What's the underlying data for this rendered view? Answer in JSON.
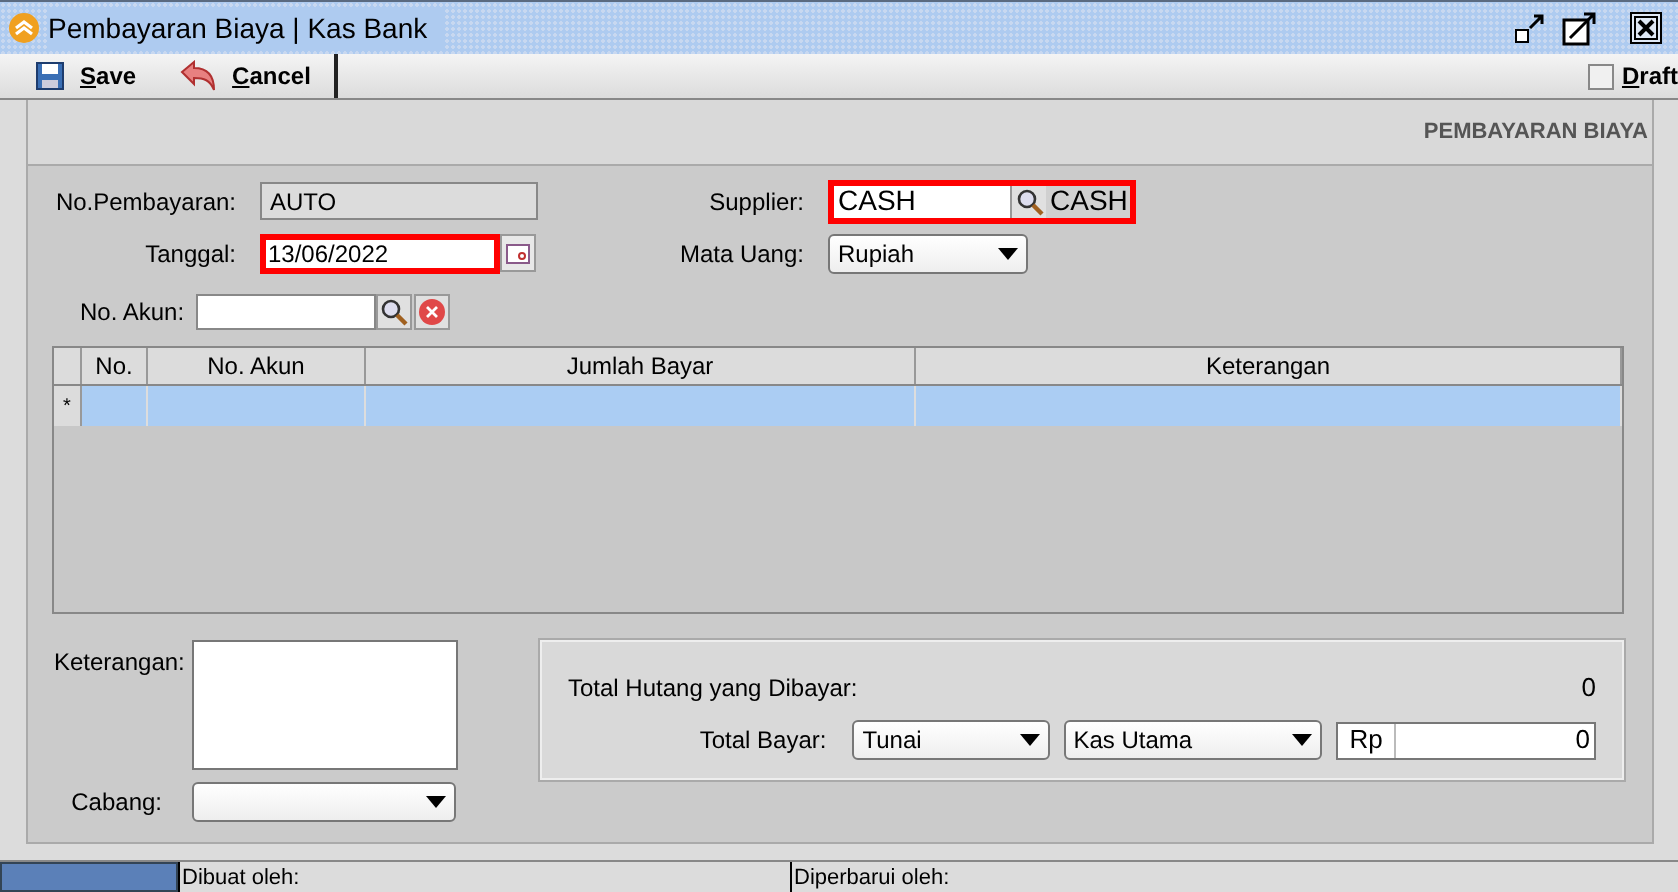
{
  "window": {
    "title": "Pembayaran Biaya | Kas Bank"
  },
  "toolbar": {
    "buttons": [
      {
        "label": "Save",
        "kind": "save"
      },
      {
        "label": "Cancel",
        "kind": "cancel"
      }
    ],
    "draft": {
      "label": "Draft",
      "checked": false
    }
  },
  "form_title": "PEMBAYARAN BIAYA",
  "fields": {
    "no_pembayaran": {
      "label": "No.Pembayaran:",
      "value": "AUTO"
    },
    "tanggal": {
      "label": "Tanggal:",
      "value": "13/06/2022",
      "required": true
    },
    "supplier": {
      "label": "Supplier:",
      "value": "CASH",
      "name": "CASH",
      "required": true
    },
    "mata_uang": {
      "label": "Mata Uang:",
      "value": "Rupiah"
    },
    "no_akun": {
      "label": "No. Akun:"
    }
  },
  "table": {
    "columns": [
      "No.",
      "No. Akun",
      "Jumlah Bayar",
      "Keterangan"
    ],
    "new_row_marker": "*"
  },
  "keterangan": {
    "label": "Keterangan:"
  },
  "cabang": {
    "label": "Cabang:"
  },
  "totals": {
    "hutang_label": "Total Hutang yang Dibayar:",
    "hutang_value": "0",
    "bayar_label": "Total Bayar:",
    "method": "Tunai",
    "account": "Kas Utama",
    "currency": "Rp",
    "amount": "0"
  },
  "status_bar": {
    "created": "Dibuat oleh:",
    "updated": "Diperbarui oleh:"
  }
}
